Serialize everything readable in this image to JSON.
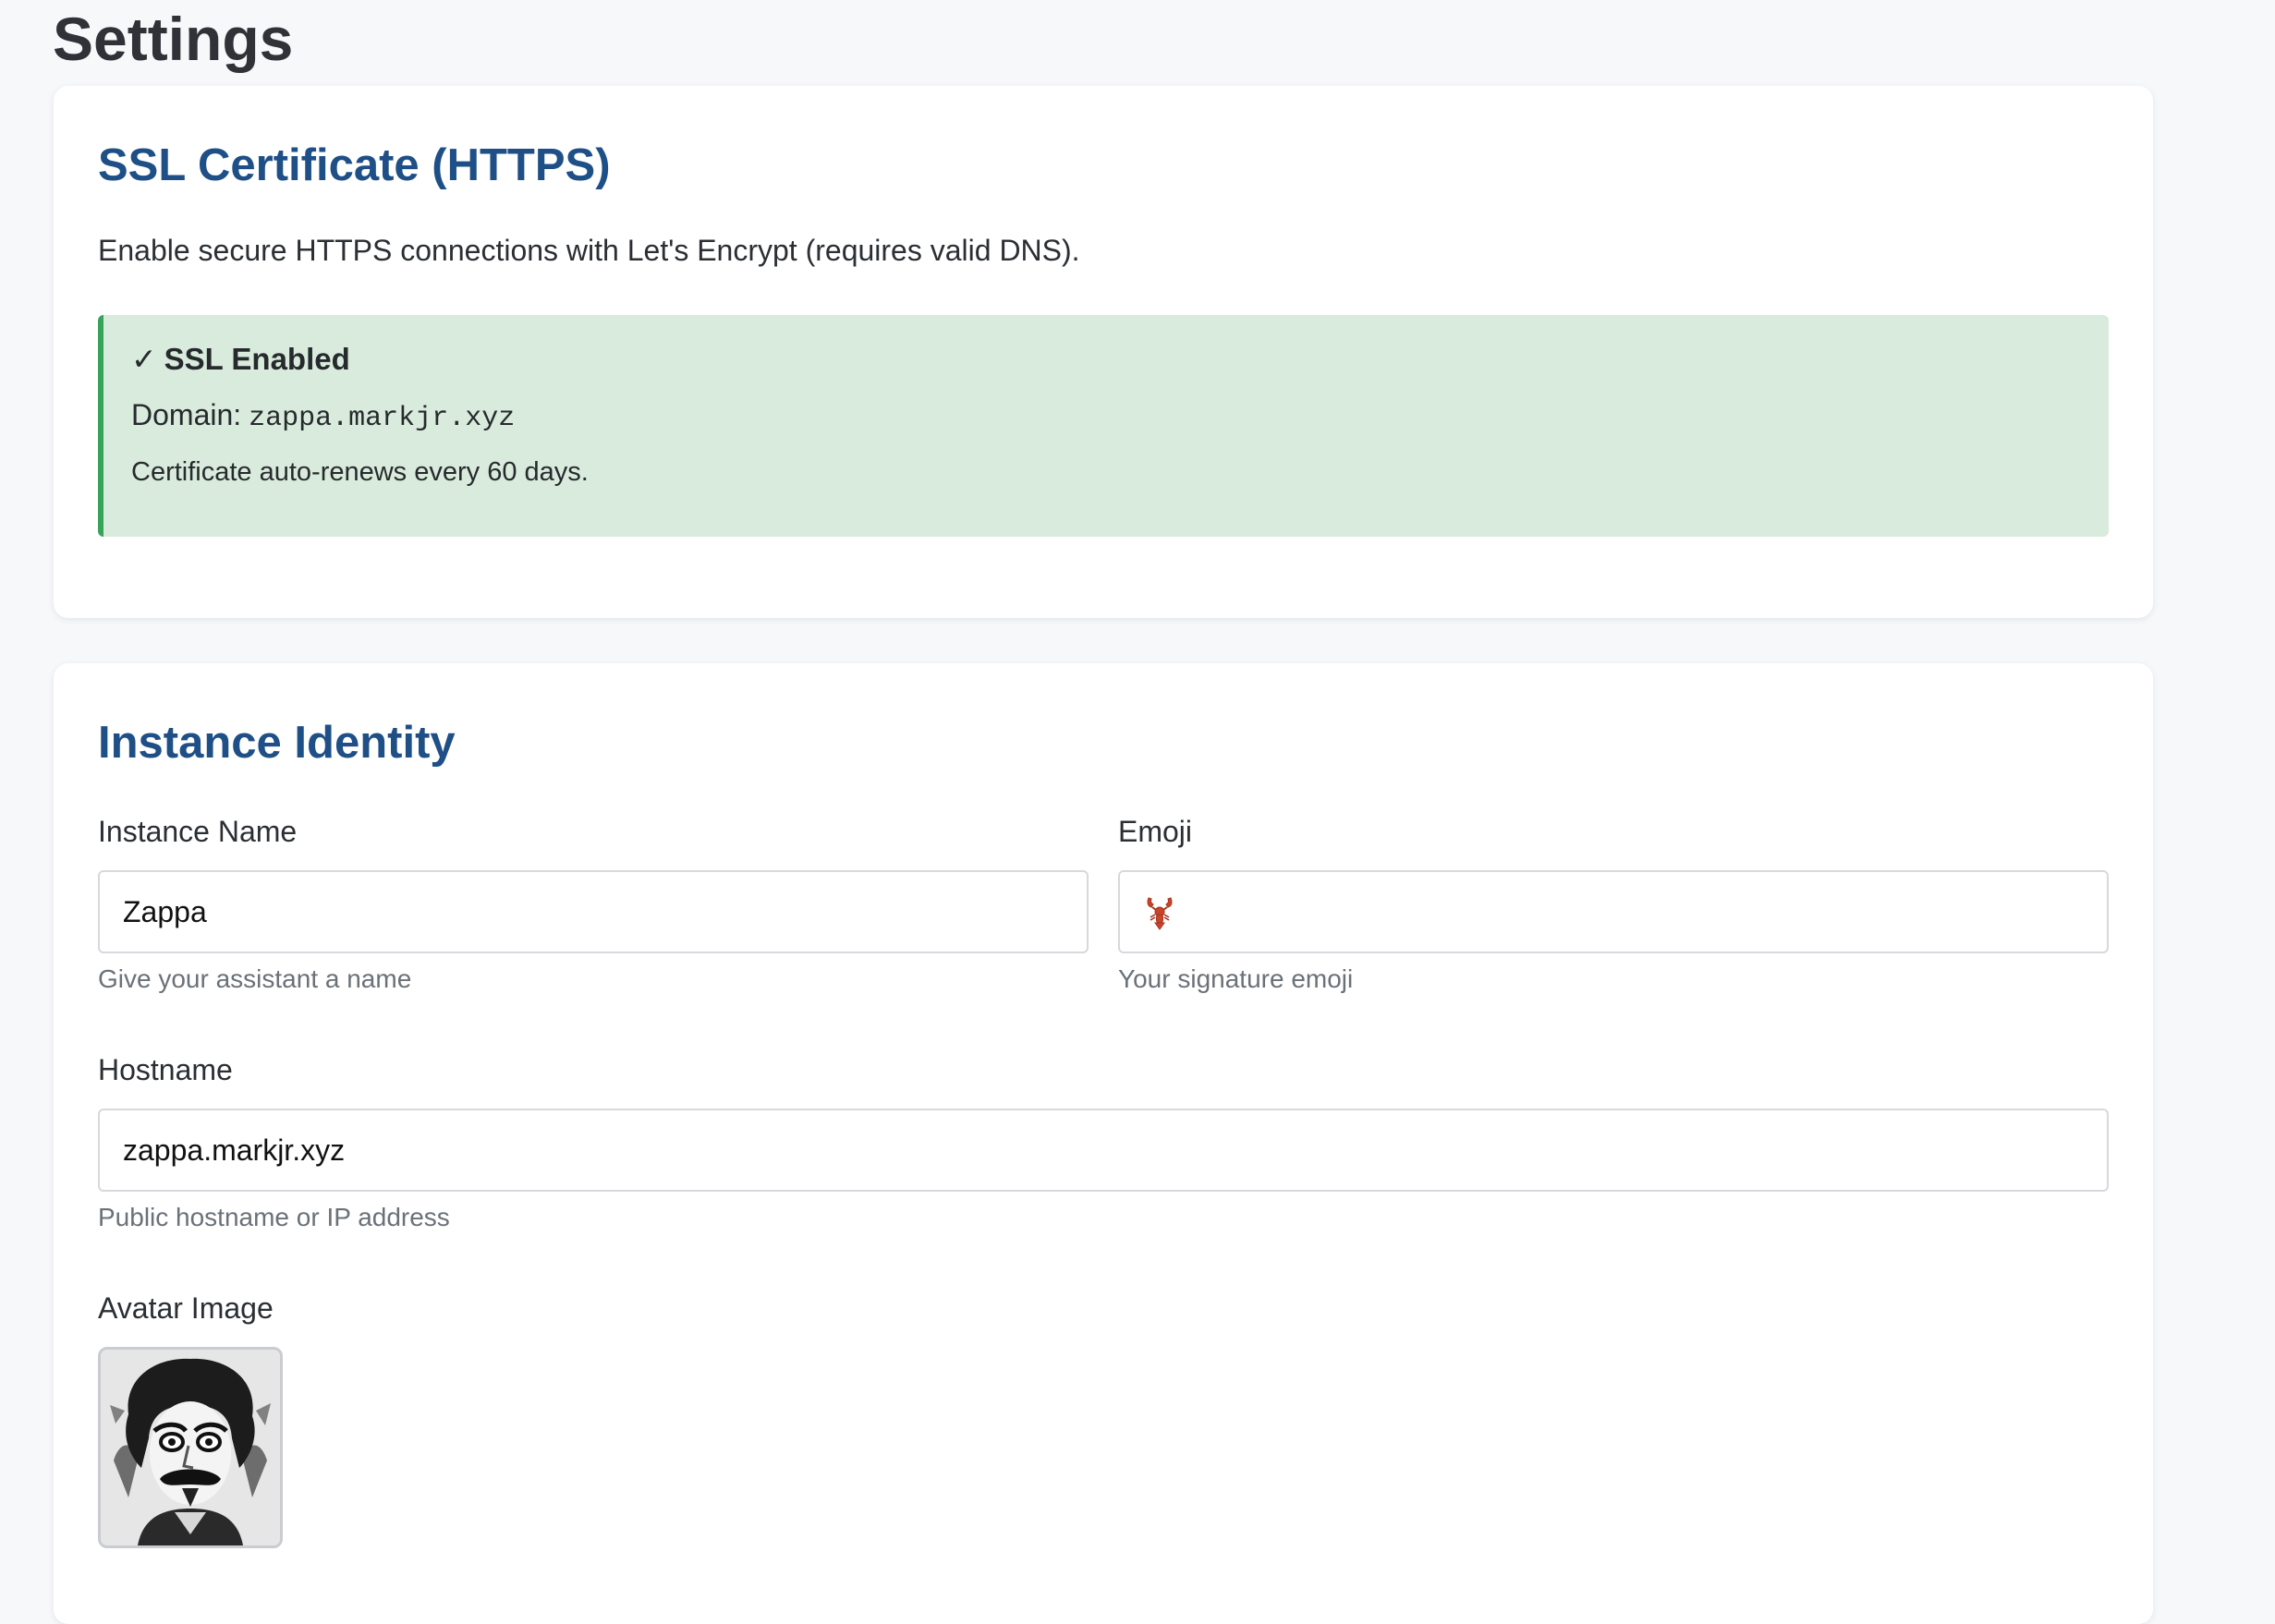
{
  "page": {
    "title": "Settings"
  },
  "ssl": {
    "title": "SSL Certificate (HTTPS)",
    "description": "Enable secure HTTPS connections with Let's Encrypt (requires valid DNS).",
    "status": {
      "check_glyph": "✓",
      "label": "SSL Enabled",
      "domain_label": "Domain:",
      "domain": "zappa.markjr.xyz",
      "renew_note": "Certificate auto-renews every 60 days.",
      "color": "#3aa35a",
      "background": "#d9ebdd"
    }
  },
  "identity": {
    "title": "Instance Identity",
    "instance_name": {
      "label": "Instance Name",
      "value": "Zappa",
      "help": "Give your assistant a name"
    },
    "emoji": {
      "label": "Emoji",
      "value_icon": "lobster-icon",
      "help": "Your signature emoji"
    },
    "hostname": {
      "label": "Hostname",
      "value": "zappa.markjr.xyz",
      "help": "Public hostname or IP address"
    },
    "avatar": {
      "label": "Avatar Image",
      "image": "avatar-portrait-image"
    }
  },
  "colors": {
    "heading": "#1e4f86",
    "page_bg": "#f7f8fa",
    "muted": "#6b7178"
  }
}
